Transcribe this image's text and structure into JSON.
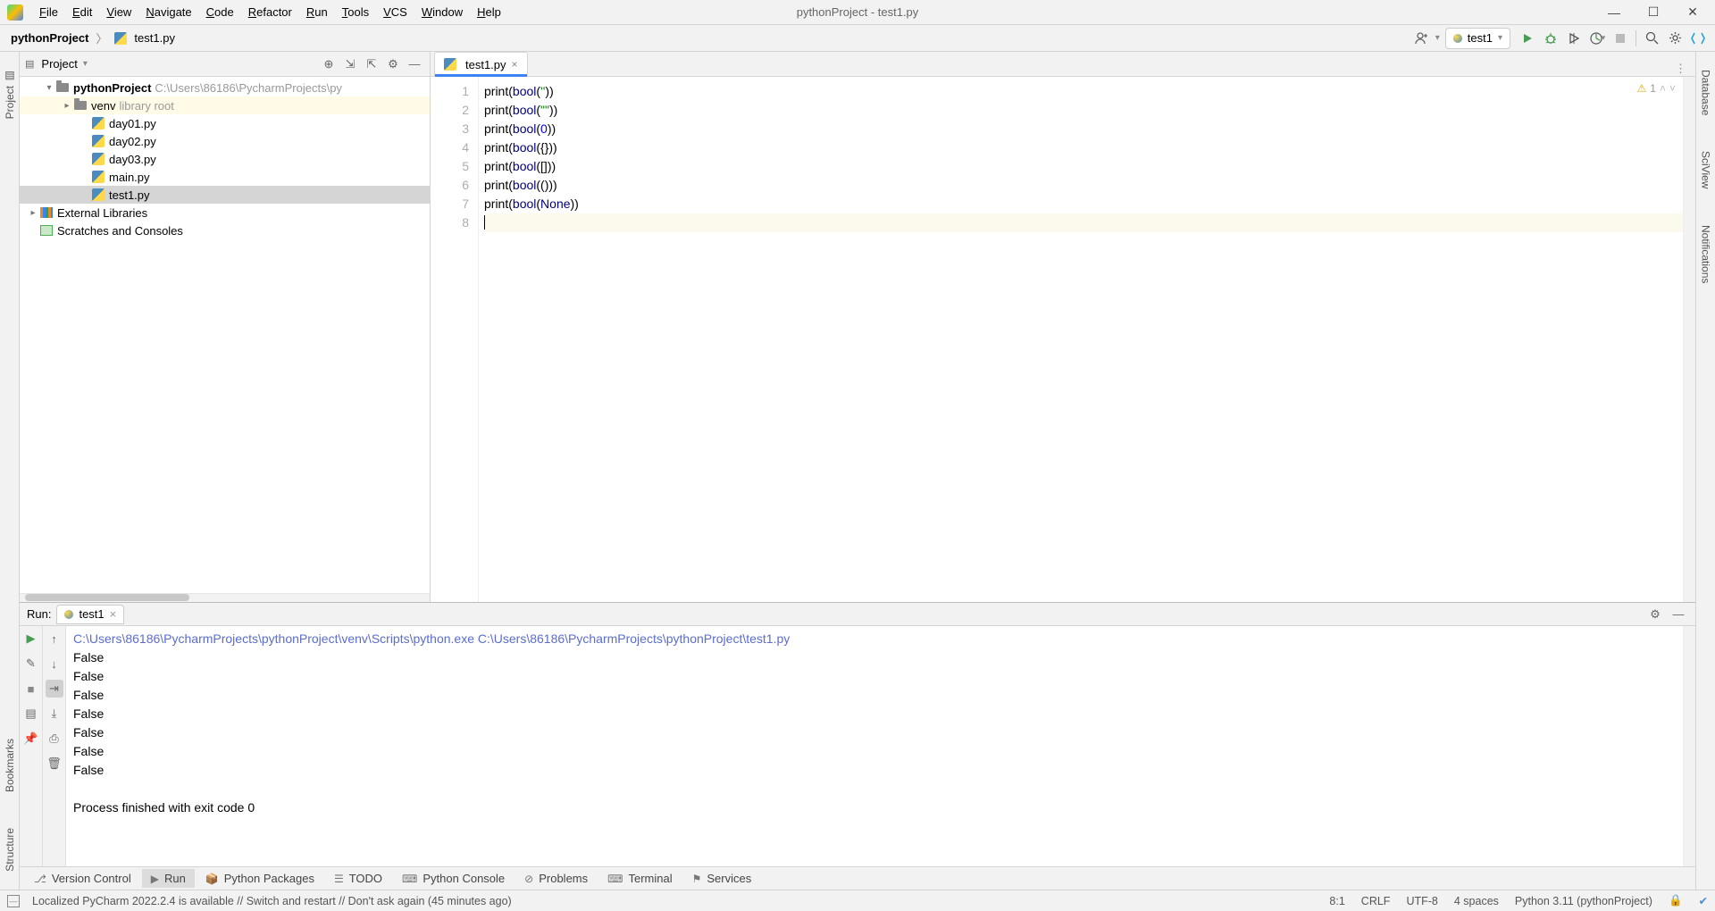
{
  "window": {
    "title": "pythonProject - test1.py"
  },
  "menu": [
    "File",
    "Edit",
    "View",
    "Navigate",
    "Code",
    "Refactor",
    "Run",
    "Tools",
    "VCS",
    "Window",
    "Help"
  ],
  "breadcrumb": {
    "project": "pythonProject",
    "file": "test1.py"
  },
  "runconfig": {
    "name": "test1"
  },
  "project_panel": {
    "title": "Project",
    "root_name": "pythonProject",
    "root_path": "C:\\Users\\86186\\PycharmProjects\\py",
    "venv_label": "venv",
    "venv_hint": "library root",
    "files": [
      "day01.py",
      "day02.py",
      "day03.py",
      "main.py",
      "test1.py"
    ],
    "ext_lib": "External Libraries",
    "scratches": "Scratches and Consoles"
  },
  "editor": {
    "tab": "test1.py",
    "warn_count": "1",
    "lines": [
      [
        {
          "t": "print",
          "c": ""
        },
        {
          "t": "(",
          "c": ""
        },
        {
          "t": "bool",
          "c": "kw-builtin"
        },
        {
          "t": "(",
          "c": ""
        },
        {
          "t": "''",
          "c": "str"
        },
        {
          "t": "))",
          "c": ""
        }
      ],
      [
        {
          "t": "print",
          "c": ""
        },
        {
          "t": "(",
          "c": ""
        },
        {
          "t": "bool",
          "c": "kw-builtin"
        },
        {
          "t": "(",
          "c": ""
        },
        {
          "t": "\"\"",
          "c": "str"
        },
        {
          "t": "))",
          "c": ""
        }
      ],
      [
        {
          "t": "print",
          "c": ""
        },
        {
          "t": "(",
          "c": ""
        },
        {
          "t": "bool",
          "c": "kw-builtin"
        },
        {
          "t": "(",
          "c": ""
        },
        {
          "t": "0",
          "c": "num"
        },
        {
          "t": "))",
          "c": ""
        }
      ],
      [
        {
          "t": "print",
          "c": ""
        },
        {
          "t": "(",
          "c": ""
        },
        {
          "t": "bool",
          "c": "kw-builtin"
        },
        {
          "t": "({}))",
          "c": ""
        }
      ],
      [
        {
          "t": "print",
          "c": ""
        },
        {
          "t": "(",
          "c": ""
        },
        {
          "t": "bool",
          "c": "kw-builtin"
        },
        {
          "t": "([]))",
          "c": ""
        }
      ],
      [
        {
          "t": "print",
          "c": ""
        },
        {
          "t": "(",
          "c": ""
        },
        {
          "t": "bool",
          "c": "kw-builtin"
        },
        {
          "t": "(()))",
          "c": ""
        }
      ],
      [
        {
          "t": "print",
          "c": ""
        },
        {
          "t": "(",
          "c": ""
        },
        {
          "t": "bool",
          "c": "kw-builtin"
        },
        {
          "t": "(",
          "c": ""
        },
        {
          "t": "None",
          "c": "none"
        },
        {
          "t": "))",
          "c": ""
        }
      ],
      []
    ]
  },
  "run": {
    "label": "Run:",
    "tab": "test1",
    "cmd": "C:\\Users\\86186\\PycharmProjects\\pythonProject\\venv\\Scripts\\python.exe C:\\Users\\86186\\PycharmProjects\\pythonProject\\test1.py",
    "output": [
      "False",
      "False",
      "False",
      "False",
      "False",
      "False",
      "False"
    ],
    "exit": "Process finished with exit code 0"
  },
  "bottom_tools": [
    "Version Control",
    "Run",
    "Python Packages",
    "TODO",
    "Python Console",
    "Problems",
    "Terminal",
    "Services"
  ],
  "status": {
    "message": "Localized PyCharm 2022.2.4 is available // Switch and restart // Don't ask again (45 minutes ago)",
    "pos": "8:1",
    "eol": "CRLF",
    "enc": "UTF-8",
    "indent": "4 spaces",
    "interp": "Python 3.11 (pythonProject)"
  },
  "left_tabs": [
    "Project",
    "Bookmarks",
    "Structure"
  ],
  "right_tabs": [
    "Database",
    "SciView",
    "Notifications"
  ]
}
